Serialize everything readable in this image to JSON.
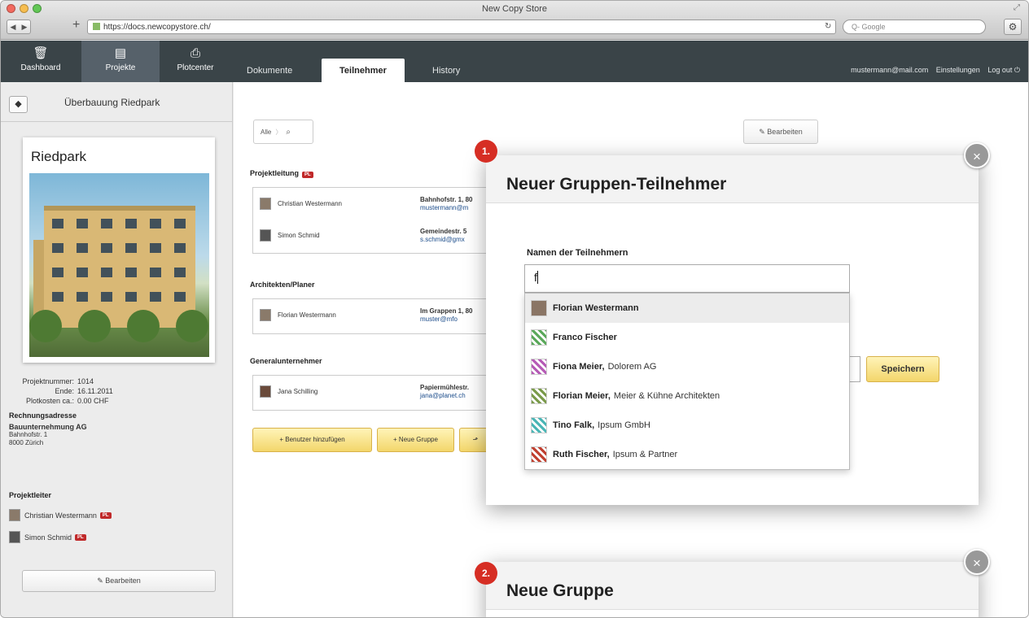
{
  "window": {
    "title": "New Copy Store",
    "url": "https://docs.newcopystore.ch/",
    "search_placeholder": "Q- Google"
  },
  "appnav": {
    "items": [
      {
        "label": "Dashboard",
        "icon": "trash-icon"
      },
      {
        "label": "Projekte",
        "icon": "printer-icon"
      },
      {
        "label": "Plotcenter",
        "icon": "plotter-icon"
      }
    ],
    "tabs": [
      "Dokumente",
      "Teilnehmer",
      "History"
    ],
    "user_email": "mustermann@mail.com",
    "settings": "Einstellungen",
    "logout": "Log out"
  },
  "sidebar": {
    "title": "Überbauung Riedpark",
    "card_title": "Riedpark",
    "meta": [
      {
        "k": "Projektnummer:",
        "v": "1014"
      },
      {
        "k": "Ende:",
        "v": "16.11.2011"
      },
      {
        "k": "Plotkosten ca.:",
        "v": "0.00 CHF"
      }
    ],
    "billing_heading": "Rechnungsadresse",
    "billing_lines": [
      "Bauunternehmung AG",
      "Bahnhofstr. 1",
      "8000 Zürich"
    ],
    "leads_heading": "Projektleiter",
    "leads": [
      {
        "name": "Christian Westermann",
        "badge": "PL"
      },
      {
        "name": "Simon Schmid",
        "badge": "PL"
      }
    ],
    "edit_label": "Bearbeiten"
  },
  "main": {
    "filter_label": "Alle",
    "edit_label": "Bearbeiten",
    "sections": [
      {
        "title": "Projektleitung",
        "badge": "PL",
        "rows": [
          {
            "name": "Christian Westermann",
            "addr": "Bahnhofstr. 1, 80",
            "mail": "mustermann@m"
          },
          {
            "name": "Simon Schmid",
            "addr": "Gemeindestr. 5",
            "mail": "s.schmid@gmx"
          }
        ]
      },
      {
        "title": "Architekten/Planer",
        "rows": [
          {
            "name": "Florian Westermann",
            "addr": "Im Grappen 1, 80",
            "mail": "muster@mfo"
          }
        ]
      },
      {
        "title": "Generalunternehmer",
        "rows": [
          {
            "name": "Jana Schilling",
            "addr": "Papiermühlestr.",
            "mail": "jana@planet.ch"
          }
        ]
      }
    ],
    "buttons": [
      "+ Benutzer hinzufügen",
      "+ Neue Gruppe"
    ]
  },
  "dialog1": {
    "badge": "1.",
    "title": "Neuer Gruppen-Teilnehmer",
    "field_label": "Namen der Teilnehmern",
    "input_value": "f",
    "suggestions": [
      {
        "name": "Florian Westermann",
        "company": "",
        "color": "#8a7565"
      },
      {
        "name": "Franco Fischer",
        "company": "",
        "color": "#5aa85a"
      },
      {
        "name": "Fiona Meier,",
        "company": "Dolorem AG",
        "color": "#b55ab5"
      },
      {
        "name": "Florian Meier,",
        "company": "Meier & Kühne Architekten",
        "color": "#7a9a4a"
      },
      {
        "name": "Tino Falk,",
        "company": "Ipsum GmbH",
        "color": "#4ab5b5"
      },
      {
        "name": "Ruth Fischer,",
        "company": "Ipsum & Partner",
        "color": "#c04030"
      }
    ],
    "save_label": "Speichern"
  },
  "dialog2": {
    "badge": "2.",
    "title": "Neue Gruppe"
  }
}
